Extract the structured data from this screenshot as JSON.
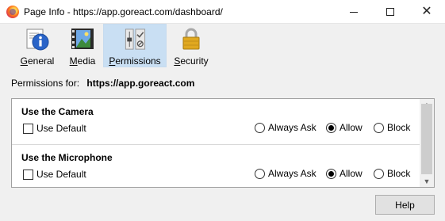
{
  "window": {
    "title": "Page Info - https://app.goreact.com/dashboard/",
    "minimize_icon": "minimize-icon",
    "maximize_icon": "maximize-icon",
    "close_glyph": "✕"
  },
  "tabs": [
    {
      "label": "General",
      "icon": "info-icon",
      "selected": false
    },
    {
      "label": "Media",
      "icon": "media-icon",
      "selected": false
    },
    {
      "label": "Permissions",
      "icon": "sliders-icon",
      "selected": true
    },
    {
      "label": "Security",
      "icon": "padlock-icon",
      "selected": false
    }
  ],
  "permissions_for": {
    "label": "Permissions for:",
    "host": "https://app.goreact.com"
  },
  "permissions": [
    {
      "title": "Use the Camera",
      "use_default_label": "Use Default",
      "use_default_checked": false,
      "options": [
        "Always Ask",
        "Allow",
        "Block"
      ],
      "selected": "Allow"
    },
    {
      "title": "Use the Microphone",
      "use_default_label": "Use Default",
      "use_default_checked": false,
      "options": [
        "Always Ask",
        "Allow",
        "Block"
      ],
      "selected": "Allow"
    }
  ],
  "scroll_arrows": {
    "up": "▲",
    "down": "▼"
  },
  "help_button": "Help",
  "colors": {
    "selected_tab": "#c9dff3",
    "window_bg": "#f0f0f0"
  }
}
